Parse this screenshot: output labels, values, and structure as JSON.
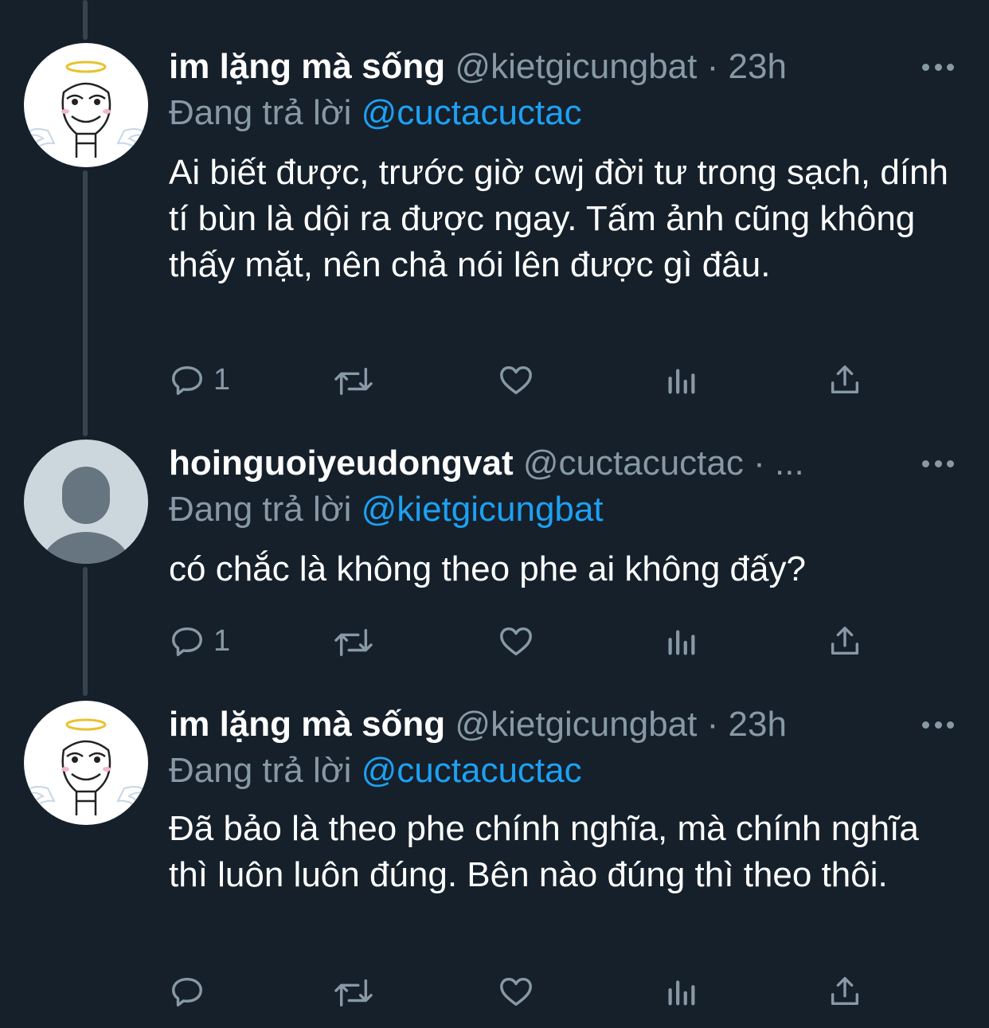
{
  "colors": {
    "background": "#15202b",
    "secondary_text": "#8899a6",
    "link": "#1da1f2",
    "thread_line": "#38444d"
  },
  "tweets": [
    {
      "display_name": "im lặng mà sống",
      "handle": "@kietgicungbat",
      "separator": "·",
      "time": "23h",
      "reply_prefix": "Đang trả lời",
      "reply_to": "@cuctacuctac",
      "text": "Ai biết được, trước giờ cwj đời tư trong sạch, dính tí bùn là dội ra được ngay. Tấm ảnh cũng không thấy mặt, nên chả nói lên được gì đâu.",
      "reply_count": "1",
      "avatar_icon": "angel-meme-face-icon"
    },
    {
      "display_name": "hoinguoiyeudongvat",
      "handle": "@cuctacuctac",
      "separator": "·",
      "time": "...",
      "reply_prefix": "Đang trả lời",
      "reply_to": "@kietgicungbat",
      "text": "có chắc là không theo phe ai không đấy?",
      "reply_count": "1",
      "avatar_icon": "default-avatar-icon"
    },
    {
      "display_name": "im lặng mà sống",
      "handle": "@kietgicungbat",
      "separator": "·",
      "time": "23h",
      "reply_prefix": "Đang trả lời",
      "reply_to": "@cuctacuctac",
      "text": "Đã bảo là theo phe chính nghĩa, mà chính nghĩa thì luôn luôn đúng. Bên nào đúng thì theo thôi.",
      "reply_count": "",
      "avatar_icon": "angel-meme-face-icon"
    }
  ]
}
